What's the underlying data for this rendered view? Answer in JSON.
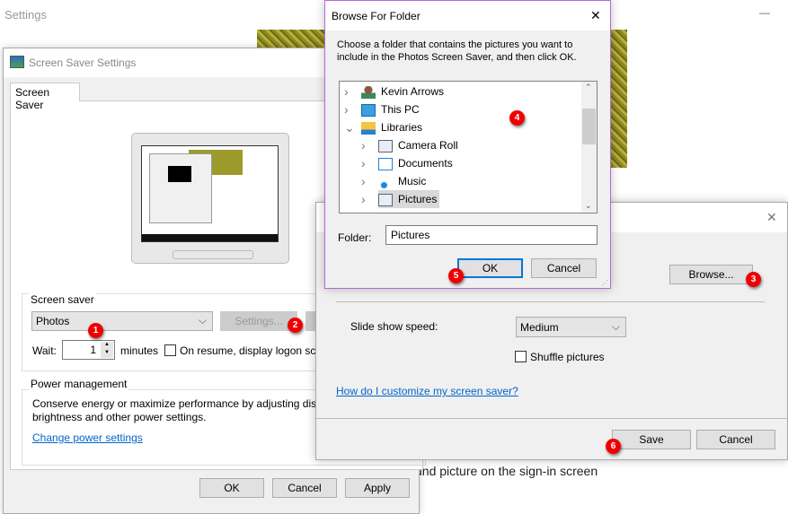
{
  "background": {
    "title": "Settings",
    "minimize": "—",
    "bottom_text": "und picture on the sign-in screen"
  },
  "screen_saver_dialog": {
    "title": "Screen Saver Settings",
    "tab": "Screen Saver",
    "group_screen_saver": "Screen saver",
    "selected_saver": "Photos",
    "settings_button": "Settings...",
    "wait_label": "Wait:",
    "wait_value": "1",
    "minutes_label": "minutes",
    "resume_checkbox": "On resume, display logon scr",
    "group_power": "Power management",
    "power_text": "Conserve energy or maximize performance by adjusting disp brightness and other power settings.",
    "power_link": "Change power settings",
    "ok": "OK",
    "cancel": "Cancel",
    "apply": "Apply"
  },
  "photos_settings_dialog": {
    "close": "✕",
    "browse": "Browse...",
    "speed_label": "Slide show speed:",
    "speed_value": "Medium",
    "shuffle_label": "Shuffle pictures",
    "help_link": "How do I customize my screen saver?",
    "save": "Save",
    "cancel": "Cancel"
  },
  "browse_dialog": {
    "title": "Browse For Folder",
    "close": "✕",
    "instruction": "Choose a folder that contains the pictures you want to include in the Photos Screen Saver, and then click OK.",
    "tree": [
      {
        "label": "Kevin Arrows",
        "icon": "user-icon",
        "level": 0,
        "expanded": false
      },
      {
        "label": "This PC",
        "icon": "computer-icon",
        "level": 0,
        "expanded": false
      },
      {
        "label": "Libraries",
        "icon": "libraries-icon",
        "level": 0,
        "expanded": true
      },
      {
        "label": "Camera Roll",
        "icon": "pictures-library-icon",
        "level": 1,
        "expanded": false
      },
      {
        "label": "Documents",
        "icon": "documents-icon",
        "level": 1,
        "expanded": false
      },
      {
        "label": "Music",
        "icon": "music-icon",
        "level": 1,
        "expanded": false
      },
      {
        "label": "Pictures",
        "icon": "pictures-library-icon",
        "level": 1,
        "expanded": false,
        "selected": true
      }
    ],
    "folder_label": "Folder:",
    "folder_value": "Pictures",
    "ok": "OK",
    "cancel": "Cancel"
  },
  "badges": [
    "1",
    "2",
    "3",
    "4",
    "5",
    "6"
  ],
  "colors": {
    "badge": "#e00000",
    "link": "#0066cc",
    "accent_border": "#0078d7",
    "browse_border": "#b36ad8"
  }
}
